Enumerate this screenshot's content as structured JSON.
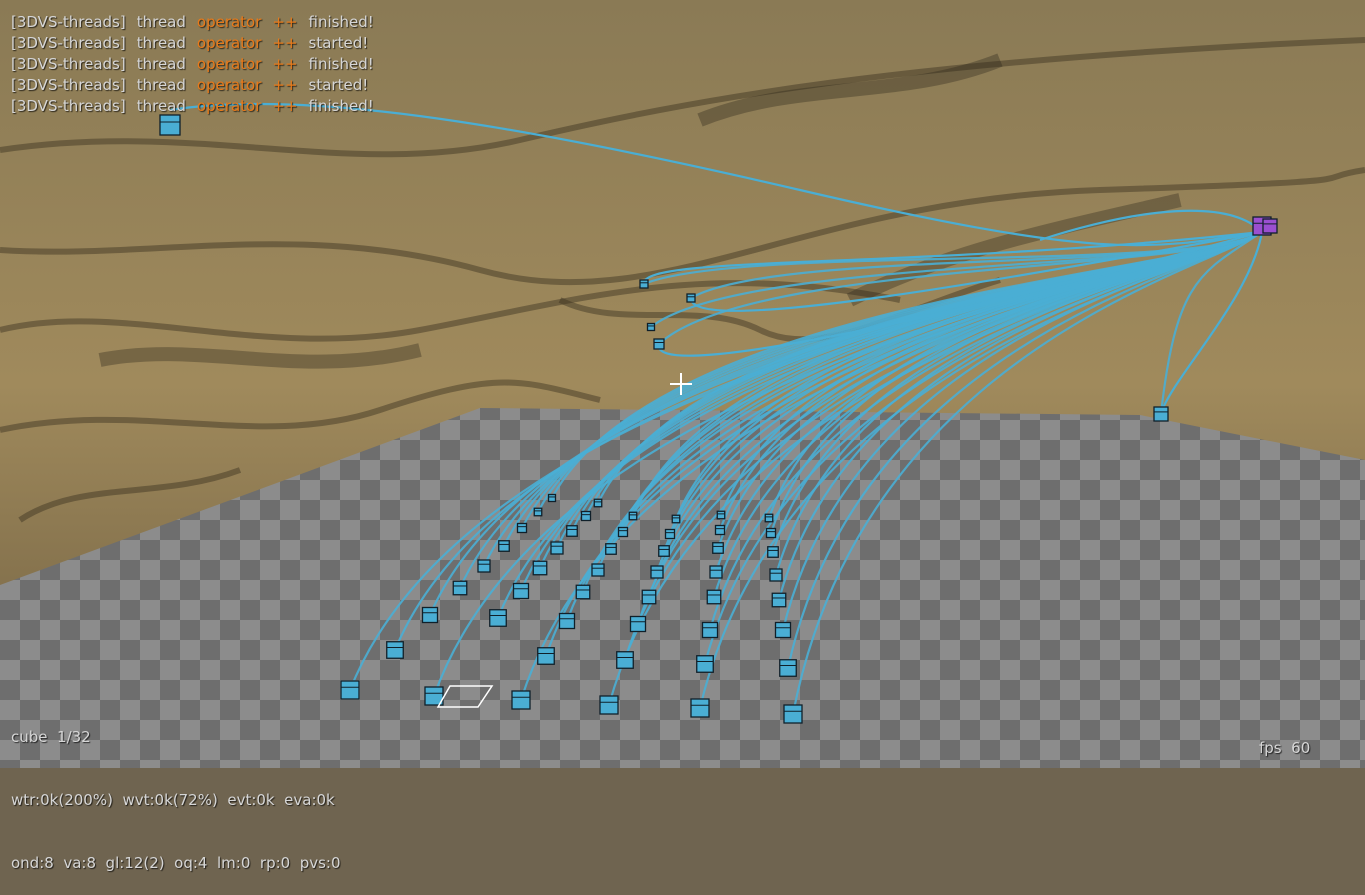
{
  "log": [
    {
      "prefix": "[3DVS-threads]",
      "word1": "thread",
      "keyword": "operator",
      "op": "++",
      "status": "finished!"
    },
    {
      "prefix": "[3DVS-threads]",
      "word1": "thread",
      "keyword": "operator",
      "op": "++",
      "status": "started!"
    },
    {
      "prefix": "[3DVS-threads]",
      "word1": "thread",
      "keyword": "operator",
      "op": "++",
      "status": "finished!"
    },
    {
      "prefix": "[3DVS-threads]",
      "word1": "thread",
      "keyword": "operator",
      "op": "++",
      "status": "started!"
    },
    {
      "prefix": "[3DVS-threads]",
      "word1": "thread",
      "keyword": "operator",
      "op": "++",
      "status": "finished!"
    }
  ],
  "stats": {
    "line1": "cube  1/32",
    "line2": "wtr:0k(200%)  wvt:0k(72%)  evt:0k  eva:0k",
    "line3": "ond:8  va:8  gl:12(2)  oq:4  lm:0  rp:0  pvs:0"
  },
  "fps": "fps  60",
  "colors": {
    "wire": "#4aaed4",
    "cube": "#4aaed4",
    "hub": "#9b4fd0",
    "keyword": "#e87a1a",
    "hud_text": "#d6d6d6"
  },
  "icons": {
    "crosshair": "crosshair-icon"
  }
}
